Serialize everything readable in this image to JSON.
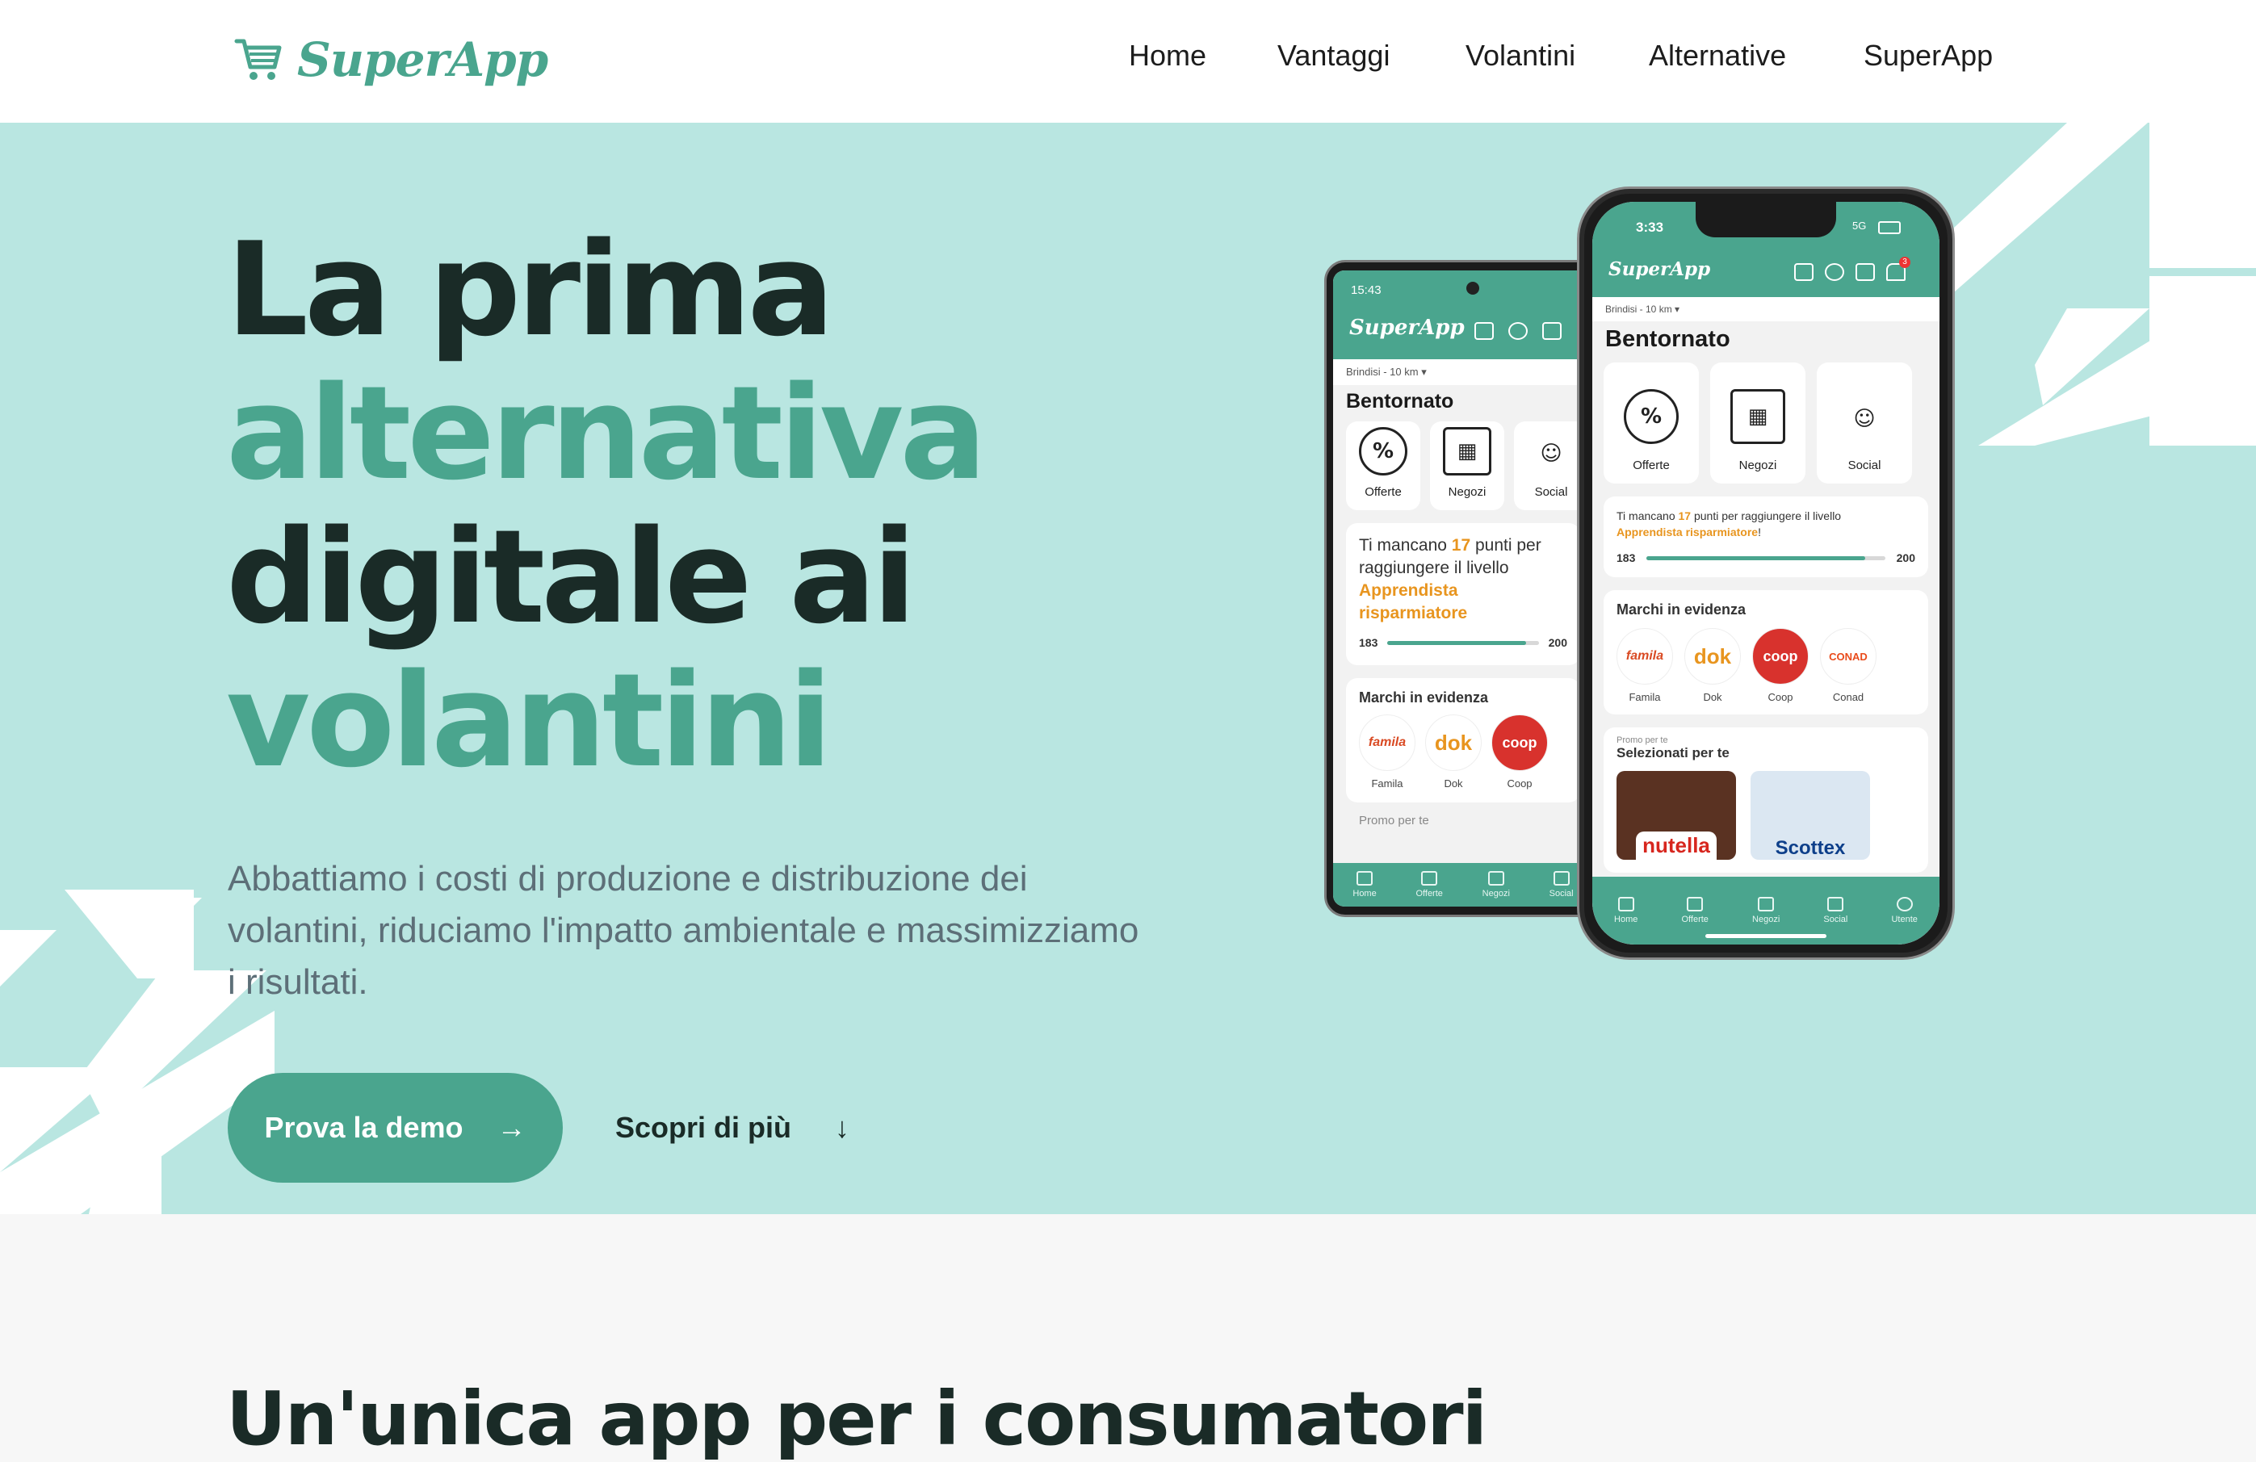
{
  "colors": {
    "accent": "#4aa58e",
    "hero_bg": "#b9e6e1",
    "dark_text": "#1a2b27",
    "orange": "#e8951f"
  },
  "header": {
    "logo": "SuperApp",
    "nav": [
      "Home",
      "Vantaggi",
      "Volantini",
      "Alternative",
      "SuperApp"
    ]
  },
  "hero": {
    "headline": [
      "La prima",
      "alternativa",
      "digitale ai",
      "volantini"
    ],
    "subtitle": "Abbattiamo i costi di produzione e distribuzione dei volantini, riduciamo l'impatto ambientale e massimizziamo i risultati.",
    "cta_primary": "Prova la demo",
    "cta_secondary": "Scopri di più"
  },
  "android_phone": {
    "time": "15:43",
    "logo": "SuperApp",
    "location": "Brindisi - 10 km",
    "greeting": "Bentornato",
    "cards": [
      "Offerte",
      "Negozi",
      "Social"
    ],
    "points_text_1": "Ti mancano",
    "points_value": "17",
    "points_text_2": "punti per raggiungere il livello",
    "level_name": "Apprendista risparmiatore",
    "progress_from": "183",
    "progress_to": "200",
    "progress_fraction": 0.915,
    "brands_title": "Marchi in evidenza",
    "brands": [
      "Famila",
      "Dok",
      "Coop"
    ],
    "promo_label": "Promo per te",
    "tabs": [
      "Home",
      "Offerte",
      "Negozi",
      "Social"
    ]
  },
  "iphone": {
    "time": "3:33",
    "signal": "5G",
    "badge": "3",
    "logo": "SuperApp",
    "location": "Brindisi - 10 km",
    "greeting": "Bentornato",
    "cards": [
      "Offerte",
      "Negozi",
      "Social"
    ],
    "points_text_1": "Ti mancano",
    "points_value": "17",
    "points_text_2": "punti per raggiungere il livello",
    "level_name": "Apprendista risparmiatore",
    "level_suffix": "!",
    "progress_from": "183",
    "progress_to": "200",
    "progress_fraction": 0.915,
    "brands_title": "Marchi in evidenza",
    "brands": [
      "Famila",
      "Dok",
      "Coop",
      "Conad"
    ],
    "promo_label": "Promo per te",
    "promo_title": "Selezionati per te",
    "products": [
      "nutella",
      "Scottex"
    ],
    "tabs": [
      "Home",
      "Offerte",
      "Negozi",
      "Social",
      "Utente"
    ]
  },
  "next_section": {
    "title": "Un'unica app per i consumatori"
  }
}
